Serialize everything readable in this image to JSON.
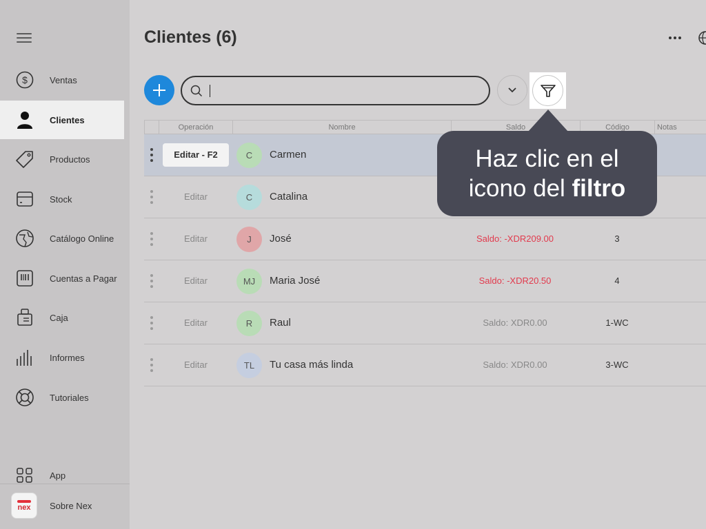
{
  "sidebar": {
    "items": [
      {
        "label": "Ventas",
        "icon": "dollar-circle-icon"
      },
      {
        "label": "Clientes",
        "icon": "person-icon"
      },
      {
        "label": "Productos",
        "icon": "tag-icon"
      },
      {
        "label": "Stock",
        "icon": "box-icon"
      },
      {
        "label": "Catálogo Online",
        "icon": "globe-leaf-icon"
      },
      {
        "label": "Cuentas a Pagar",
        "icon": "barcode-icon"
      },
      {
        "label": "Caja",
        "icon": "cash-register-icon"
      },
      {
        "label": "Informes",
        "icon": "bar-chart-icon"
      },
      {
        "label": "Tutoriales",
        "icon": "lifebuoy-icon"
      }
    ],
    "app_label": "App",
    "about_label": "Sobre Nex",
    "logo_text": "nex"
  },
  "header": {
    "title": "Clientes (6)"
  },
  "search": {
    "value": "",
    "placeholder": ""
  },
  "table": {
    "columns": [
      "Operación",
      "Nombre",
      "Saldo",
      "Código",
      "Notas"
    ],
    "rows": [
      {
        "edit": "Editar - F2",
        "initials": "C",
        "name": "Carmen",
        "saldo": "",
        "codigo": "",
        "avatar_color": "#b9dcb6",
        "saldo_color": "#888888"
      },
      {
        "edit": "Editar",
        "initials": "C",
        "name": "Catalina",
        "saldo": "",
        "codigo": "",
        "avatar_color": "#b6dcdc",
        "saldo_color": "#888888"
      },
      {
        "edit": "Editar",
        "initials": "J",
        "name": "José",
        "saldo": "Saldo: -XDR209.00",
        "codigo": "3",
        "avatar_color": "#e0a6a8",
        "saldo_color": "#e23a4d"
      },
      {
        "edit": "Editar",
        "initials": "MJ",
        "name": "Maria José",
        "saldo": "Saldo: -XDR20.50",
        "codigo": "4",
        "avatar_color": "#b9dcb6",
        "saldo_color": "#e23a4d"
      },
      {
        "edit": "Editar",
        "initials": "R",
        "name": "Raul",
        "saldo": "Saldo: XDR0.00",
        "codigo": "1-WC",
        "avatar_color": "#b9dcb6",
        "saldo_color": "#888888"
      },
      {
        "edit": "Editar",
        "initials": "TL",
        "name": "Tu casa más linda",
        "saldo": "Saldo: XDR0.00",
        "codigo": "3-WC",
        "avatar_color": "#c5cee0",
        "saldo_color": "#888888"
      }
    ]
  },
  "tooltip": {
    "line1": "Haz clic en el",
    "line2_prefix": "icono del ",
    "line2_bold": "filtro"
  },
  "colors": {
    "accent": "#1e88db",
    "negative": "#e23a4d",
    "tooltip_bg": "#484955"
  }
}
